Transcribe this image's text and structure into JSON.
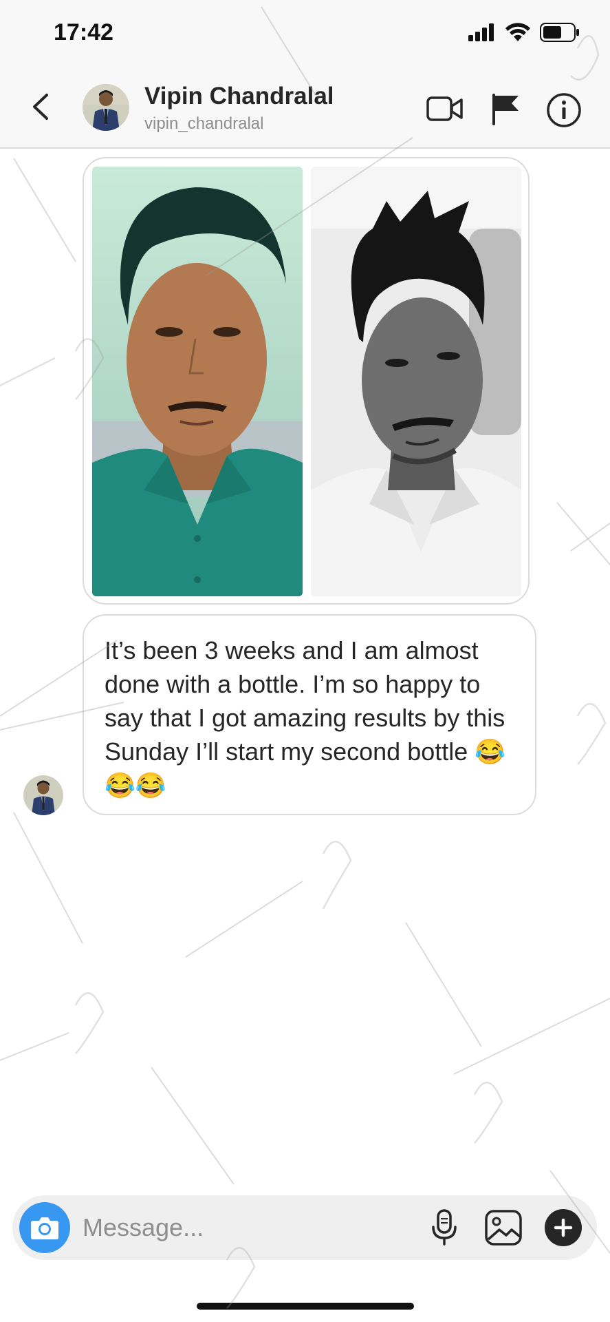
{
  "status_bar": {
    "time": "17:42",
    "icons": [
      "signal-icon",
      "wifi-icon",
      "battery-icon"
    ]
  },
  "header": {
    "contact_name": "Vipin Chandralal",
    "contact_username": "vipin_chandralal",
    "icons": [
      "back-icon",
      "video-call-icon",
      "flag-icon",
      "info-icon"
    ]
  },
  "conversation": {
    "media_message": {
      "photos": [
        "color selfie, green polo shirt",
        "black & white selfie, white polo shirt"
      ]
    },
    "text_message": {
      "text": "It’s been 3 weeks and I am almost done with a bottle. I’m so happy to say that I got amazing results by this Sunday I’ll start my second bottle 😂😂😂"
    }
  },
  "composer": {
    "placeholder": "Message...",
    "icons": [
      "camera-icon",
      "microphone-icon",
      "gallery-icon",
      "plus-icon"
    ]
  },
  "colors": {
    "accent": "#3897f0",
    "text": "#262626",
    "secondary_text": "#8e8e8e",
    "border": "#dbdbdb",
    "header_bg": "#f8f8f8"
  }
}
